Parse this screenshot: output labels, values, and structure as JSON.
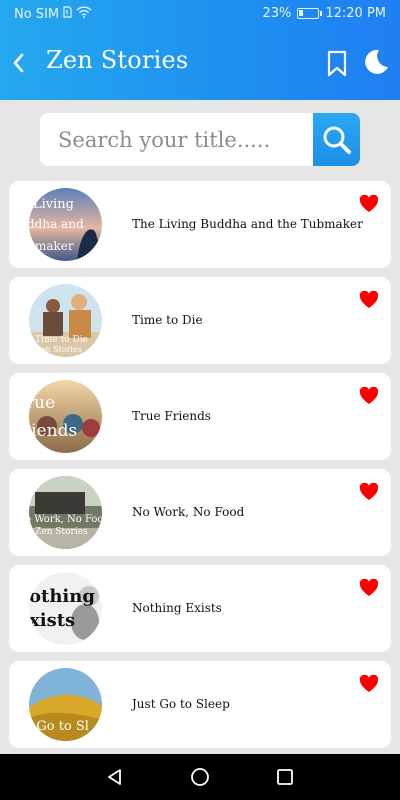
{
  "status": {
    "carrier": "No SIM",
    "battery": "23%",
    "battery_level": 0.23,
    "time": "12:20 PM"
  },
  "header": {
    "title": "Zen Stories",
    "bg_color": "#1f8ff0"
  },
  "search": {
    "placeholder": "Search your title....."
  },
  "stories": [
    {
      "title": "The Living Buddha and the Tubmaker",
      "thumb_text": "Living ddha and maker",
      "favorite": true
    },
    {
      "title": "Time to Die",
      "thumb_text": "Time to Die Zen Stories",
      "favorite": true
    },
    {
      "title": "True Friends",
      "thumb_text": "True friends",
      "favorite": true
    },
    {
      "title": "No Work, No Food",
      "thumb_text": "No Work, No Food Zen Stories",
      "favorite": true
    },
    {
      "title": "Nothing Exists",
      "thumb_text": "othing xists",
      "favorite": true
    },
    {
      "title": "Just Go to Sleep",
      "thumb_text": "t Go to Sl",
      "favorite": true
    }
  ],
  "colors": {
    "accent": "#1f8ff0",
    "heart": "#ff0000",
    "card_bg": "#ffffff",
    "page_bg": "#e6e6e6"
  }
}
